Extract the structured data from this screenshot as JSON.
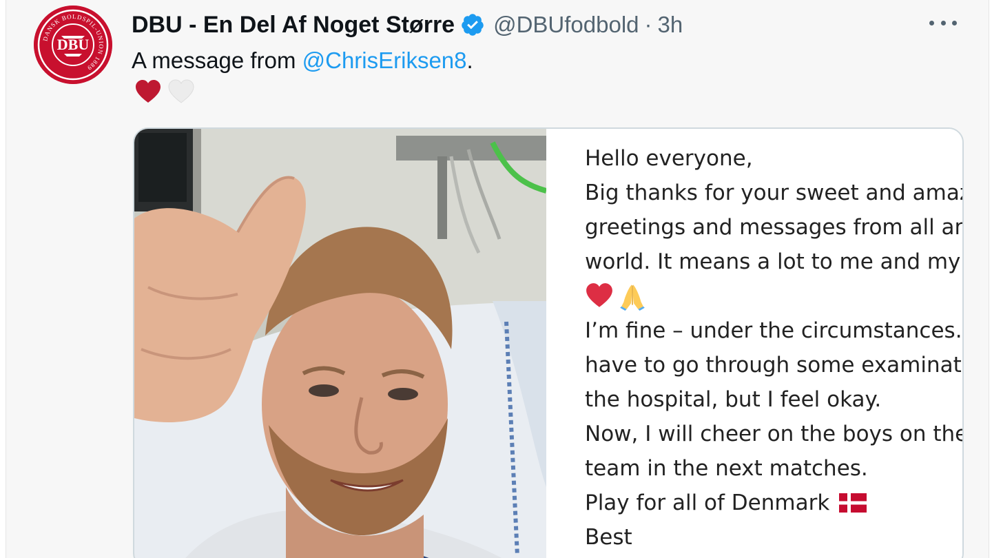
{
  "tweet": {
    "account": {
      "display_name": "DBU - En Del Af Noget Større",
      "handle": "@DBUfodbold",
      "separator": "·",
      "time": "3h",
      "verified": true,
      "avatar_icon": "dbu-crest-icon",
      "avatar_logo_text": "DBU",
      "avatar_ring_text": "DANSK BOLDSPIL-UNION 1889"
    },
    "text_prefix": "A message from ",
    "mention": "@ChrisEriksen8",
    "text_suffix": ".",
    "emojis": [
      "red-heart-icon",
      "white-heart-icon"
    ],
    "more_icon": "more-options-icon",
    "media": {
      "photo_icon": "hospital-selfie-photo",
      "note_lines": [
        "Hello everyone,",
        "Big thanks for your sweet and amaz",
        "greetings and messages from all ar",
        "world. It means a lot to me and my",
        "",
        "I’m fine – under the circumstances.",
        "have to go through some examinati",
        "the hospital, but I feel okay.",
        "Now, I will cheer on the boys on the",
        "team in the next matches.",
        "Play for all of Denmark",
        "Best"
      ],
      "note_emojis": [
        "red-heart-icon",
        "folded-hands-icon"
      ],
      "flag_icon": "denmark-flag-icon"
    }
  },
  "colors": {
    "accent": "#1d9bf0",
    "dbu_red": "#c8102e",
    "text": "#0f1419",
    "muted": "#536471"
  }
}
